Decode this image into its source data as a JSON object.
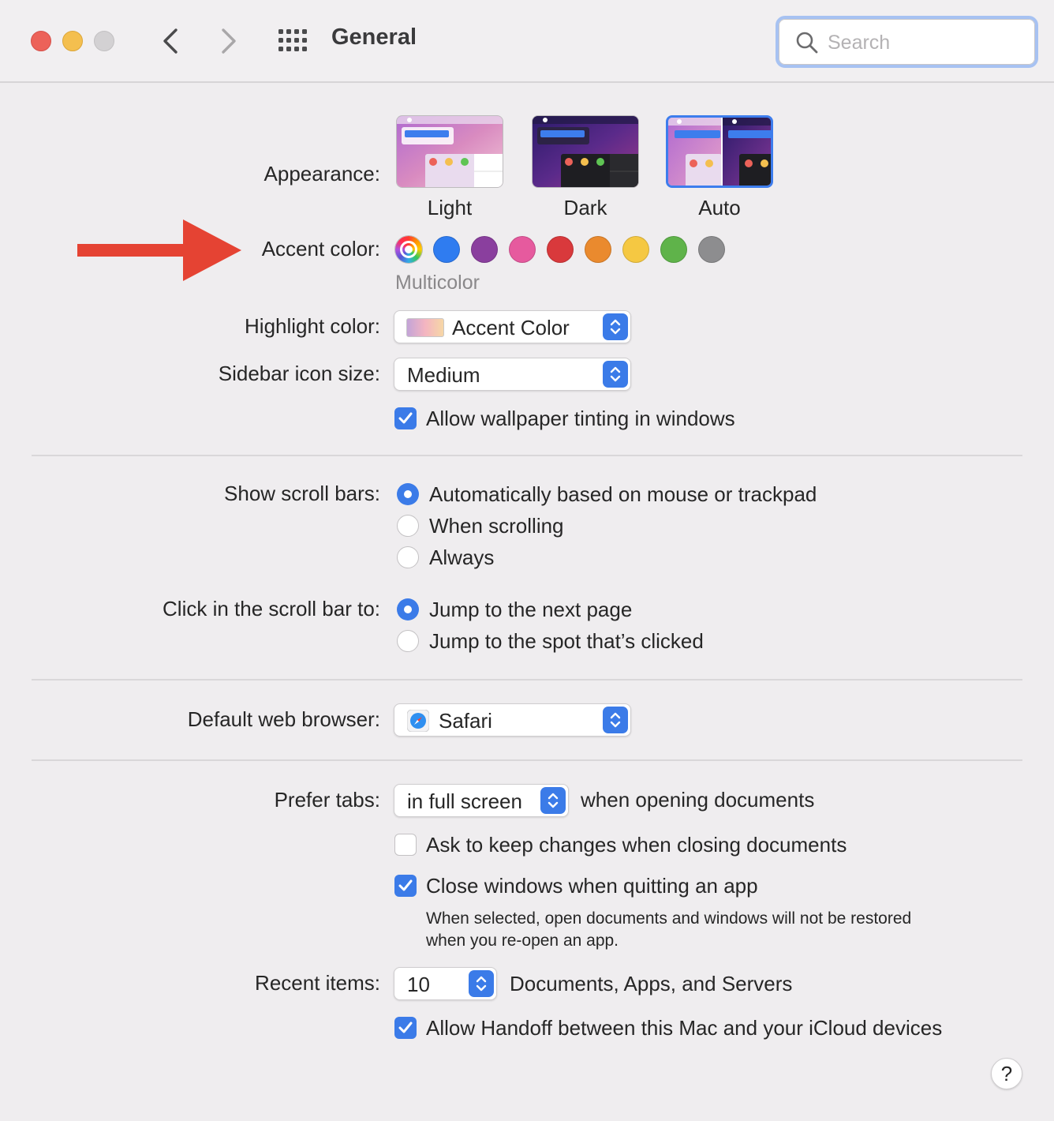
{
  "window": {
    "title": "General",
    "search_placeholder": "Search"
  },
  "appearance": {
    "label": "Appearance:",
    "options": [
      {
        "name": "Light",
        "selected": false
      },
      {
        "name": "Dark",
        "selected": false
      },
      {
        "name": "Auto",
        "selected": true
      }
    ]
  },
  "accent": {
    "label": "Accent color:",
    "selected_name": "Multicolor",
    "colors": [
      {
        "name": "Multicolor",
        "hex": "multicolor"
      },
      {
        "name": "Blue",
        "hex": "#2f7cf0"
      },
      {
        "name": "Purple",
        "hex": "#8a3f9e"
      },
      {
        "name": "Pink",
        "hex": "#e65a9e"
      },
      {
        "name": "Red",
        "hex": "#d9393c"
      },
      {
        "name": "Orange",
        "hex": "#ea8a2e"
      },
      {
        "name": "Yellow",
        "hex": "#f5c842"
      },
      {
        "name": "Green",
        "hex": "#5fb34a"
      },
      {
        "name": "Graphite",
        "hex": "#8d8d8f"
      }
    ]
  },
  "highlight": {
    "label": "Highlight color:",
    "value": "Accent Color"
  },
  "sidebar_icon": {
    "label": "Sidebar icon size:",
    "value": "Medium"
  },
  "wallpaper_tinting": {
    "label": "Allow wallpaper tinting in windows",
    "checked": true
  },
  "scroll_bars": {
    "label": "Show scroll bars:",
    "options": [
      {
        "label": "Automatically based on mouse or trackpad",
        "selected": true
      },
      {
        "label": "When scrolling",
        "selected": false
      },
      {
        "label": "Always",
        "selected": false
      }
    ]
  },
  "click_scroll": {
    "label": "Click in the scroll bar to:",
    "options": [
      {
        "label": "Jump to the next page",
        "selected": true
      },
      {
        "label": "Jump to the spot that’s clicked",
        "selected": false
      }
    ]
  },
  "browser": {
    "label": "Default web browser:",
    "value": "Safari",
    "icon": "safari-icon"
  },
  "prefer_tabs": {
    "label": "Prefer tabs:",
    "value": "in full screen",
    "suffix": "when opening documents"
  },
  "ask_keep_changes": {
    "label": "Ask to keep changes when closing documents",
    "checked": false
  },
  "close_windows": {
    "label": "Close windows when quitting an app",
    "checked": true,
    "note_line1": "When selected, open documents and windows will not be restored",
    "note_line2": "when you re-open an app."
  },
  "recent_items": {
    "label": "Recent items:",
    "value": "10",
    "suffix": "Documents, Apps, and Servers"
  },
  "handoff": {
    "label": "Allow Handoff between this Mac and your iCloud devices",
    "checked": true
  },
  "help": {
    "label": "?"
  },
  "colors": {
    "accent": "#3b7be8",
    "arrow": "#e54333"
  }
}
